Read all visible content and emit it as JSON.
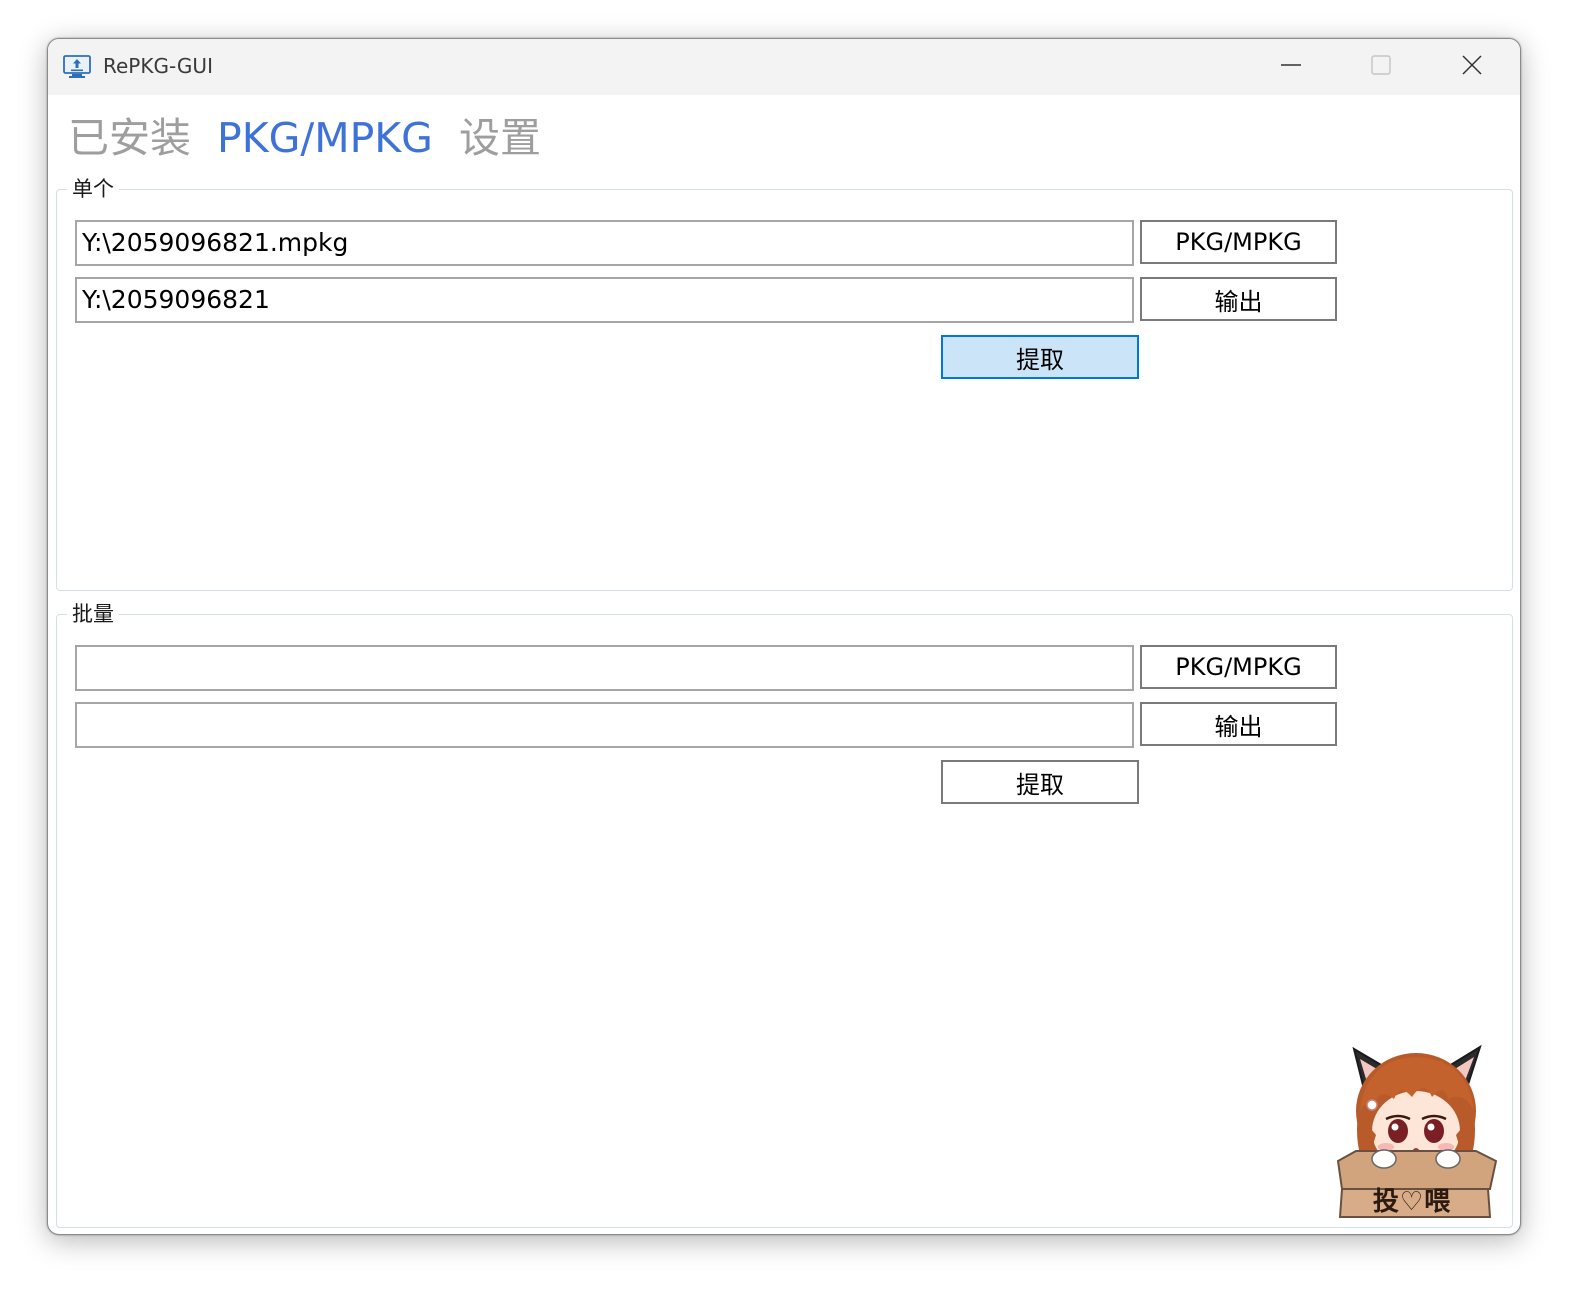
{
  "window": {
    "title": "RePKG-GUI",
    "icon": "monitor-upload-icon"
  },
  "titlebar_buttons": {
    "minimize": "minimize-icon",
    "maximize": "maximize-icon",
    "close": "close-icon"
  },
  "tabs": [
    {
      "label": "已安装",
      "active": false
    },
    {
      "label": "PKG/MPKG",
      "active": true
    },
    {
      "label": "设置",
      "active": false
    }
  ],
  "single": {
    "legend": "单个",
    "input_path": "Y:\\2059096821.mpkg",
    "output_path": "Y:\\2059096821",
    "pkg_button": "PKG/MPKG",
    "output_button": "输出",
    "extract_button": "提取"
  },
  "batch": {
    "legend": "批量",
    "input_path": "",
    "output_path": "",
    "pkg_button": "PKG/MPKG",
    "output_button": "输出",
    "extract_button": "提取"
  },
  "mascot": {
    "label": "投♡喂",
    "image": "anime-girl-in-box-icon"
  },
  "colors": {
    "active_tab": "#3f72d8",
    "inactive_tab": "#9e9e9e",
    "focused_button_bg": "#cce4f7",
    "focused_button_border": "#0078d4"
  }
}
